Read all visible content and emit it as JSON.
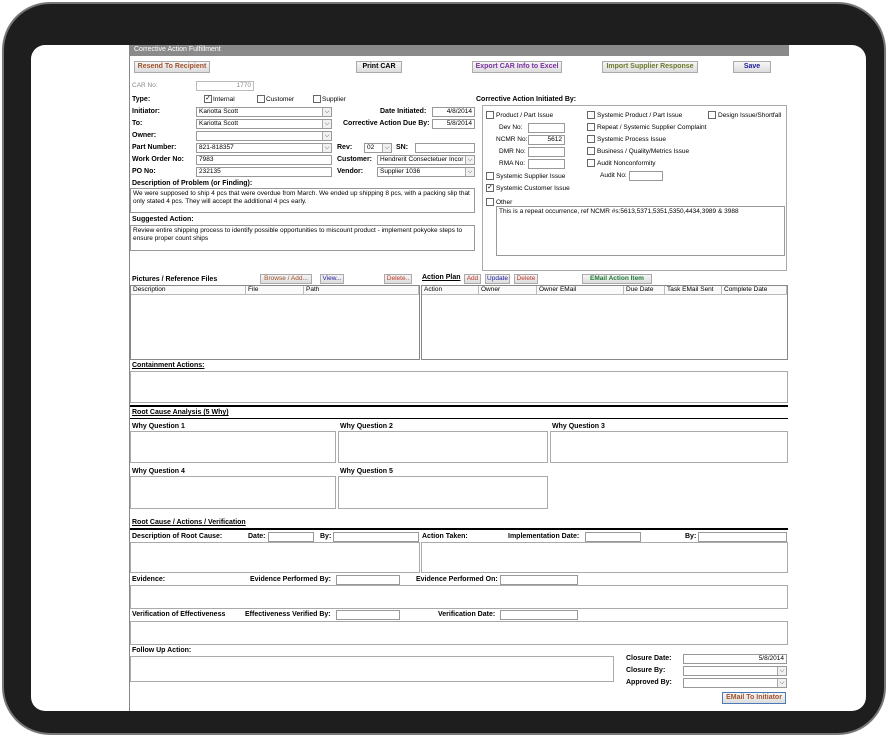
{
  "window": {
    "title": "Corrective Action Fulfillment"
  },
  "toolbar": {
    "resend": "Resend To Recipient",
    "print": "Print CAR",
    "export": "Export CAR Info to Excel",
    "import": "Import Supplier Response",
    "save": "Save"
  },
  "header": {
    "car_no_label": "CAR No:",
    "car_no": "1770",
    "type_label": "Type:",
    "type_internal": "Internal",
    "type_customer": "Customer",
    "type_supplier": "Supplier",
    "initiator_label": "Initiator:",
    "initiator": "Kariotta Scott",
    "to_label": "To:",
    "to": "Kariotta Scott",
    "owner_label": "Owner:",
    "owner": "",
    "part_label": "Part Number:",
    "part": "821-818357",
    "rev_label": "Rev:",
    "rev": "02",
    "sn_label": "SN:",
    "sn": "",
    "wo_label": "Work Order No:",
    "wo": "7983",
    "customer_label": "Customer:",
    "customer": "Hendrerit Consectetuer Incor",
    "po_label": "PO No:",
    "po": "232135",
    "vendor_label": "Vendor:",
    "vendor": "Supplier 1036",
    "date_initiated_label": "Date Initiated:",
    "date_initiated": "4/8/2014",
    "due_label": "Corrective Action Due By:",
    "due": "5/8/2014"
  },
  "problem": {
    "label": "Description of Problem (or Finding):",
    "text": "We were supposed to ship 4 pcs that were overdue from March.  We ended up shipping 8 pcs, with a packing slip that only stated 4 pcs.  They will accept the additional 4 pcs early.",
    "suggested_label": "Suggested Action:",
    "suggested": "Review entire shipping process to identify possible opportunities to miscount product - implement pokyoke steps to ensure proper count ships"
  },
  "initiated_by": {
    "label": "Corrective Action Initiated By:",
    "product_part": "Product / Part Issue",
    "dev_no": "Dev No:",
    "ncmr_no": "NCMR No:",
    "ncmr_value": "5612",
    "dmr_no": "DMR No:",
    "rma_no": "RMA No:",
    "systemic_supplier": "Systemic Supplier Issue",
    "systemic_customer": "Systemic Customer Issue",
    "other": "Other",
    "systemic_product": "Systemic Product / Part Issue",
    "design_issue": "Design Issue/Shortfall",
    "repeat_systemic": "Repeat / Systemic Supplier Complaint",
    "systemic_process": "Systemic Process Issue",
    "business_quality": "Business / Quality/Metrics Issue",
    "audit_nonconformity": "Audit Nonconformity",
    "audit_no": "Audit No:",
    "other_text": "This is a repeat occurrence, ref NCMR #s:5613,5371,5351,5350,4434,3989 & 3988"
  },
  "pictures": {
    "label": "Pictures / Reference Files",
    "browse": "Browse / Add...",
    "view": "View...",
    "delete": "Delete..",
    "columns": [
      "Description",
      "File",
      "Path"
    ]
  },
  "action_plan": {
    "label": "Action Plan",
    "add": "Add",
    "update": "Update",
    "delete": "Delete",
    "email_item": "EMail Action Item",
    "columns": [
      "Action",
      "Owner",
      "Owner EMail",
      "Due Date",
      "Task EMail Sent",
      "Complete Date"
    ]
  },
  "containment": {
    "label": "Containment Actions:"
  },
  "rca": {
    "label": "Root Cause Analysis (5 Why)",
    "q1": "Why Question 1",
    "q2": "Why Question 2",
    "q3": "Why Question 3",
    "q4": "Why Question 4",
    "q5": "Why Question 5"
  },
  "verification": {
    "label": "Root Cause / Actions / Verification",
    "desc_root": "Description of Root Cause:",
    "date": "Date:",
    "by": "By:",
    "action_taken": "Action Taken:",
    "impl_date": "Implementation Date:",
    "impl_by": "By:",
    "evidence": "Evidence:",
    "evidence_performed_by": "Evidence Performed  By:",
    "evidence_performed_on": "Evidence Performed On:",
    "verification_eff": "Verification of Effectiveness",
    "eff_verified_by": "Effectiveness Verified  By:",
    "verification_date": "Verification Date:"
  },
  "followup": {
    "label": "Follow Up Action:",
    "closure_date_label": "Closure Date:",
    "closure_date": "5/8/2014",
    "closure_by_label": "Closure By:",
    "approved_by_label": "Approved By:",
    "email_initiator": "EMail To Initiator"
  }
}
